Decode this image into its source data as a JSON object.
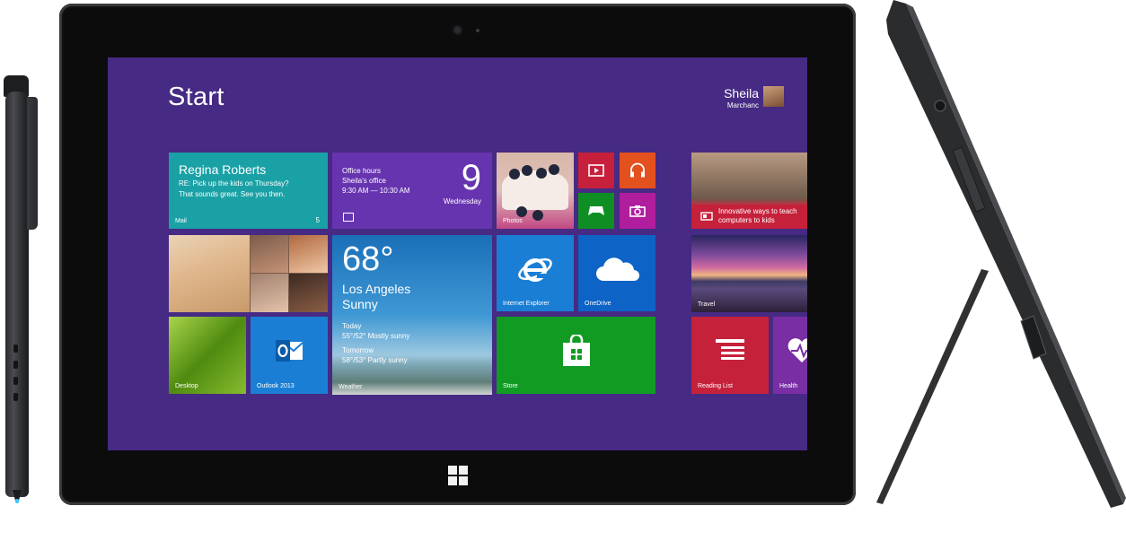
{
  "start": {
    "title": "Start"
  },
  "user": {
    "name": "Sheila",
    "surname": "Marchanc"
  },
  "tiles": {
    "mail": {
      "from": "Regina Roberts",
      "subject": "RE: Pick up the kids on Thursday?",
      "body": "That sounds great. See you then.",
      "label": "Mail",
      "count": "5"
    },
    "calendar": {
      "event": "Office hours",
      "location": "Sheila's office",
      "time": "9:30 AM — 10:30 AM",
      "day": "9",
      "weekday": "Wednesday"
    },
    "photos": {
      "label": "Photos"
    },
    "weather": {
      "temp": "68°",
      "city": "Los Angeles",
      "condition": "Sunny",
      "today_label": "Today",
      "today_fc": "55°/52° Mostly sunny",
      "tomorrow_label": "Tomorrow",
      "tomorrow_fc": "58°/53° Partly sunny",
      "label": "Weather"
    },
    "ie": {
      "label": "Internet Explorer"
    },
    "onedrive": {
      "label": "OneDrive"
    },
    "desktop": {
      "label": "Desktop"
    },
    "outlook": {
      "label": "Outlook 2013"
    },
    "store": {
      "label": "Store"
    },
    "news": {
      "text": "Innovative ways to teach computers to kids"
    },
    "travel": {
      "label": "Travel"
    },
    "reading": {
      "label": "Reading List"
    },
    "health": {
      "label": "Health"
    }
  },
  "icons": {
    "video": "video-icon",
    "music": "headphones-icon",
    "games": "gamepad-icon",
    "camera": "camera-icon",
    "ie": "internet-explorer-icon",
    "onedrive": "cloud-icon",
    "outlook": "outlook-icon",
    "store": "shopping-bag-icon",
    "reading": "reading-list-icon",
    "health": "heart-pulse-icon",
    "windows": "windows-logo-icon"
  },
  "colors": {
    "screen_bg": "#462a83",
    "mail": "#1aa1a6",
    "calendar": "#6734b0",
    "video": "#c6203c",
    "music": "#e3511f",
    "games": "#0f8f23",
    "camera": "#b01d9d",
    "ie": "#1a7fd4",
    "onedrive": "#0d63c6",
    "store": "#119b23",
    "reading": "#c6213b",
    "health": "#7a2ea4"
  }
}
